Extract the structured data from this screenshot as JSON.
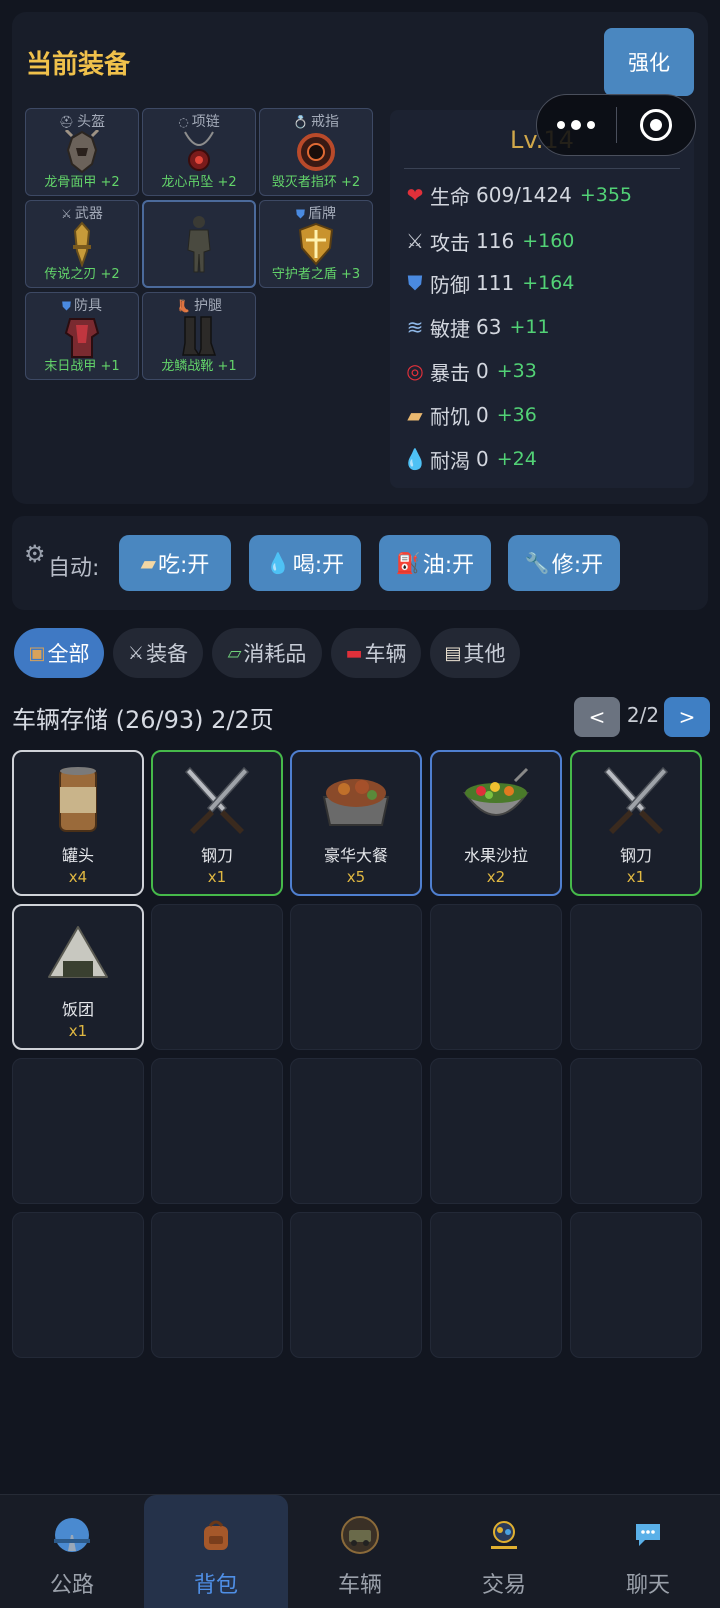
{
  "equipment": {
    "title": "当前装备",
    "enhance_label": "强化",
    "slots": [
      {
        "type": "头盔",
        "item": "龙骨面甲 +2",
        "icon": "helmet-icon"
      },
      {
        "type": "项链",
        "item": "龙心吊坠 +2",
        "icon": "necklace-icon"
      },
      {
        "type": "戒指",
        "item": "毁灭者指环 +2",
        "icon": "ring-icon"
      },
      {
        "type": "武器",
        "item": "传说之刃 +2",
        "icon": "weapon-icon"
      },
      {
        "type": "盾牌",
        "item": "守护者之盾 +3",
        "icon": "shield-icon"
      },
      {
        "type": "防具",
        "item": "末日战甲 +1",
        "icon": "armor-icon"
      },
      {
        "type": "护腿",
        "item": "龙鳞战靴 +1",
        "icon": "boots-icon"
      }
    ]
  },
  "stats": {
    "level": "Lv.14",
    "rows": [
      {
        "label": "生命",
        "value": "609/1424",
        "bonus": "+355",
        "icon": "heart-icon"
      },
      {
        "label": "攻击",
        "value": "116",
        "bonus": "+160",
        "icon": "swords-icon"
      },
      {
        "label": "防御",
        "value": "111",
        "bonus": "+164",
        "icon": "shield-icon"
      },
      {
        "label": "敏捷",
        "value": "63",
        "bonus": "+11",
        "icon": "wind-icon"
      },
      {
        "label": "暴击",
        "value": "0",
        "bonus": "+33",
        "icon": "target-icon"
      },
      {
        "label": "耐饥",
        "value": "0",
        "bonus": "+36",
        "icon": "bread-icon"
      },
      {
        "label": "耐渴",
        "value": "0",
        "bonus": "+24",
        "icon": "droplet-icon"
      }
    ]
  },
  "auto": {
    "label": "自动:",
    "buttons": [
      {
        "label": "吃:开",
        "icon": "bread-icon"
      },
      {
        "label": "喝:开",
        "icon": "droplet-icon"
      },
      {
        "label": "油:开",
        "icon": "fuel-icon"
      },
      {
        "label": "修:开",
        "icon": "wrench-icon"
      }
    ]
  },
  "filters": [
    {
      "label": "全部",
      "icon": "box-icon",
      "active": true
    },
    {
      "label": "装备",
      "icon": "swords-icon",
      "active": false
    },
    {
      "label": "消耗品",
      "icon": "syringe-icon",
      "active": false
    },
    {
      "label": "车辆",
      "icon": "car-icon",
      "active": false
    },
    {
      "label": "其他",
      "icon": "clipboard-icon",
      "active": false
    }
  ],
  "storage": {
    "title": "车辆存储 (26/93) 2/2页",
    "prev": "<",
    "page": "2/2",
    "next": ">",
    "items": [
      {
        "name": "罐头",
        "qty": "x4",
        "rarity": "white",
        "icon": "can-icon"
      },
      {
        "name": "钢刀",
        "qty": "x1",
        "rarity": "green",
        "icon": "knife-icon"
      },
      {
        "name": "豪华大餐",
        "qty": "x5",
        "rarity": "blue",
        "icon": "feast-icon"
      },
      {
        "name": "水果沙拉",
        "qty": "x2",
        "rarity": "blue",
        "icon": "salad-icon"
      },
      {
        "name": "钢刀",
        "qty": "x1",
        "rarity": "green",
        "icon": "knife-icon"
      },
      {
        "name": "饭团",
        "qty": "x1",
        "rarity": "white",
        "icon": "rice-ball-icon"
      }
    ]
  },
  "nav": [
    {
      "label": "公路",
      "icon": "road-icon",
      "active": false
    },
    {
      "label": "背包",
      "icon": "backpack-icon",
      "active": true
    },
    {
      "label": "车辆",
      "icon": "vehicle-icon",
      "active": false
    },
    {
      "label": "交易",
      "icon": "trade-icon",
      "active": false
    },
    {
      "label": "聊天",
      "icon": "chat-icon",
      "active": false
    }
  ]
}
